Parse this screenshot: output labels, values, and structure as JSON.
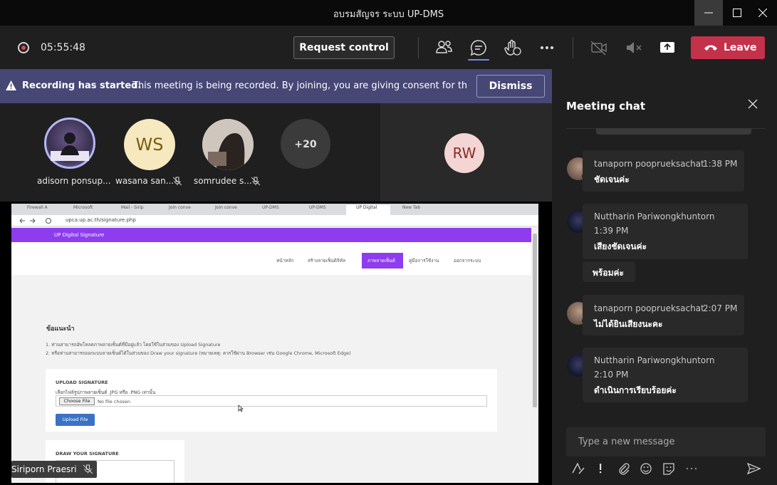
{
  "window": {
    "title": "อบรมสัญจร ระบบ UP-DMS"
  },
  "toolbar": {
    "timer": "05:55:48",
    "request_control": "Request control",
    "leave": "Leave",
    "icons": [
      "people-icon",
      "chat-icon",
      "raise-hand-icon",
      "more-icon",
      "camera-off-icon",
      "mic-off-icon",
      "share-tray-icon"
    ]
  },
  "banner": {
    "bold": "Recording has started.",
    "text": "This meeting is being recorded. By joining, you are giving consent for this...",
    "dismiss": "Dismiss"
  },
  "gallery": {
    "participants": [
      {
        "name": "adisorn ponsup...",
        "initials": "",
        "muted": false
      },
      {
        "name": "wasana san...",
        "initials": "WS",
        "muted": true
      },
      {
        "name": "somrudee s...",
        "initials": "",
        "muted": true
      },
      {
        "name": "",
        "initials": "+20",
        "muted": false
      }
    ],
    "rw": {
      "initials": "RW"
    }
  },
  "share": {
    "presenter": "Siriporn Praesri",
    "browser": {
      "tabs": [
        "Firewall A",
        "Microsoft",
        "Mail - Sirip",
        "Join conve",
        "Join conve",
        "UP-DMS",
        "UP-DMS",
        "UP Digital",
        "New Tab"
      ],
      "url": "upca.up.ac.th/signature.php",
      "site_brand": "UP Digital Signature",
      "nav": [
        "หน้าหลัก",
        "สร้างลายเซ็นดิจิทัล",
        "ภาพลายเซ็นต์",
        "คู่มือการใช้งาน",
        "ออกจากระบบ"
      ],
      "tips_title": "ข้อแนะนำ",
      "tips": [
        "1. ท่านสามารถอัพโหลดภาพลายเซ็นต์ที่มีอยู่แล้ว โดยใช้ในส่วนของ Upload Signature",
        "2. หรือท่านสามารถออกแบบลายเซ็นต์ได้ในส่วนของ Draw your signature (หมายเหตุ: ควรใช้ผ่าน Browser เช่น Google Chrome, Microsoft Edge)"
      ],
      "upload_heading": "UPLOAD SIGNATURE",
      "upload_sub": "เลือกไฟล์รูปภาพลายเซ็นต์ .JPG หรือ .PNG เท่านั้น",
      "choose_file": "Choose File",
      "no_file": "No file chosen",
      "upload_button": "Upload File",
      "draw_heading": "DRAW YOUR SIGNATURE"
    }
  },
  "chat": {
    "title": "Meeting chat",
    "messages": [
      {
        "author": "tanaporn pooprueksachat",
        "time": "1:38 PM",
        "texts": [
          "ชัดเจนค่ะ"
        ]
      },
      {
        "author": "Nuttharin Pariwongkhuntorn",
        "time": "1:39 PM",
        "texts": [
          "เสียงชัดเจนค่ะ",
          "พร้อมค่ะ"
        ]
      },
      {
        "author": "tanaporn pooprueksachat",
        "time": "2:07 PM",
        "texts": [
          "ไม่ได้ยินเสียงนะคะ"
        ]
      },
      {
        "author": "Nuttharin Pariwongkhuntorn",
        "time": "2:10 PM",
        "texts": [
          "ดำเนินการเรียบร้อยค่ะ"
        ]
      }
    ],
    "compose_placeholder": "Type a new message",
    "compose_icons": [
      "format-icon",
      "important-icon",
      "attach-icon",
      "emoji-icon",
      "sticker-icon",
      "more-options-icon",
      "send-icon"
    ]
  },
  "colors": {
    "accent": "#7f85f5",
    "leave": "#c4314b",
    "banner": "#464775",
    "site_purple": "#8d3cf0"
  }
}
